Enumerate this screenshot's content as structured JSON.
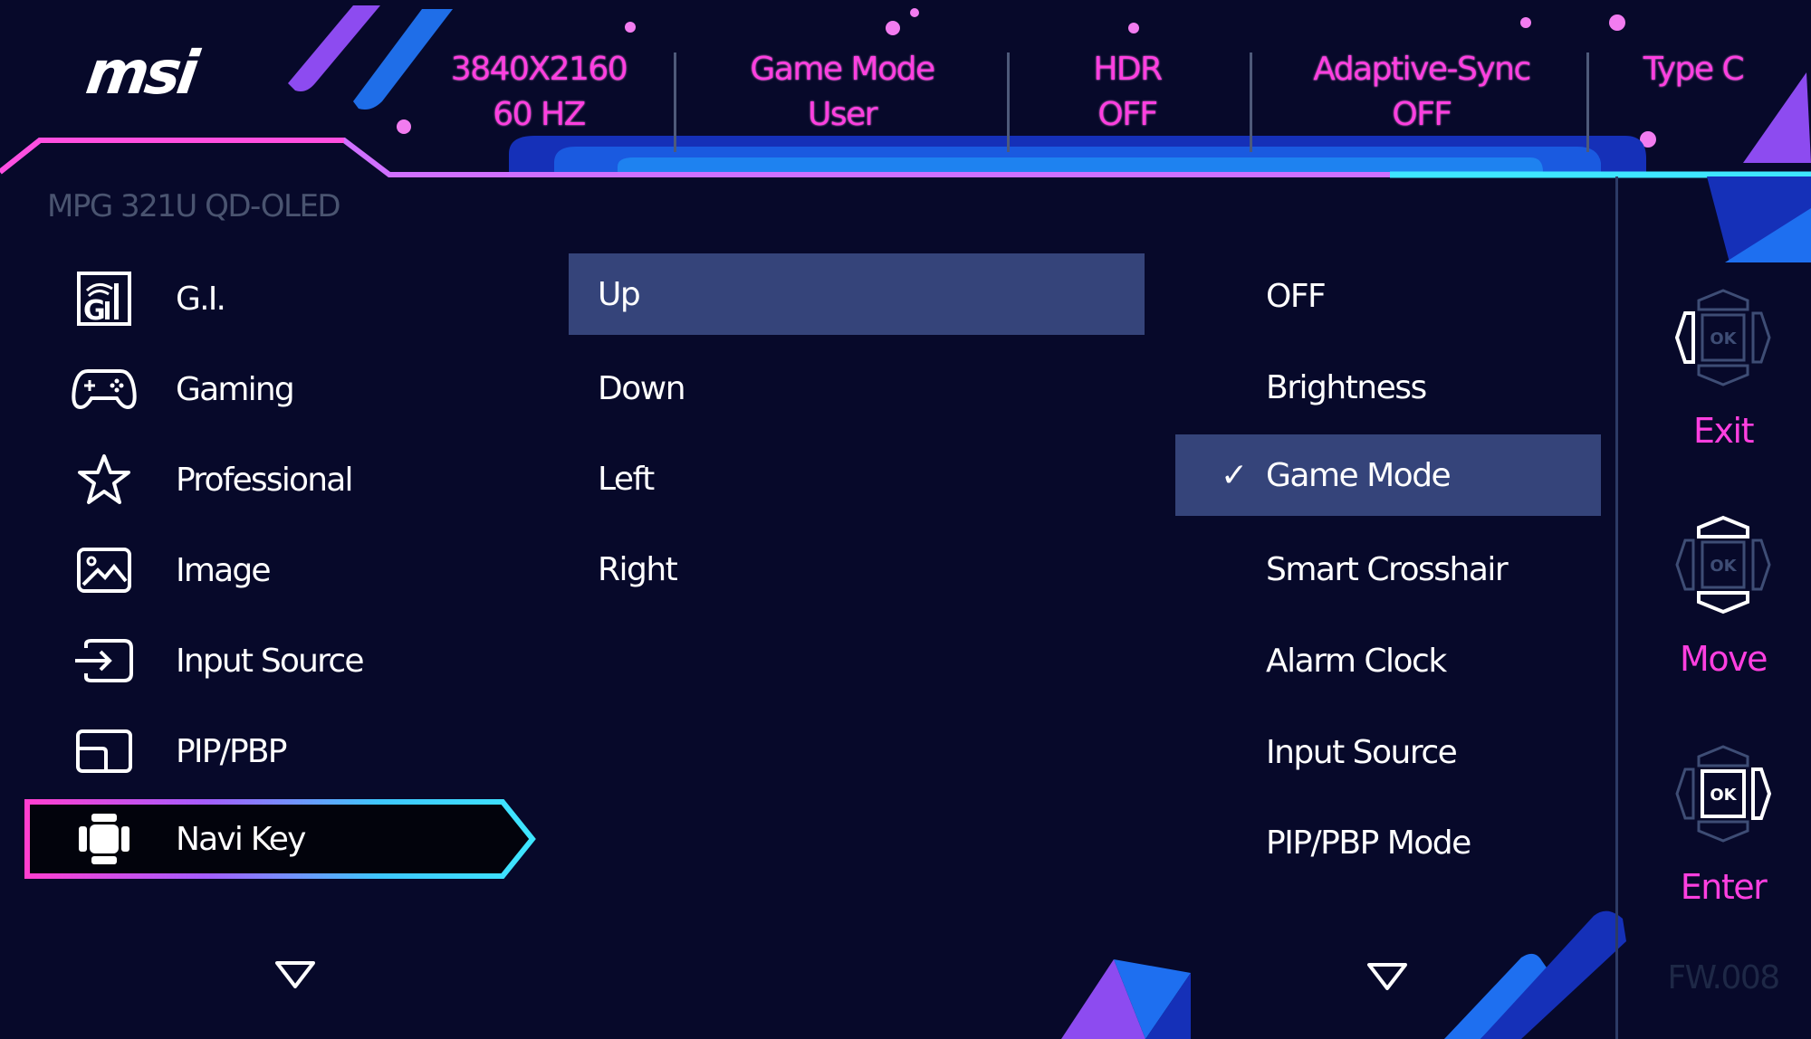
{
  "brand": {
    "logo": "msi",
    "model": "MPG 321U QD-OLED"
  },
  "status_bar": [
    {
      "title": "3840X2160",
      "value": "60 HZ"
    },
    {
      "title": "Game Mode",
      "value": "User"
    },
    {
      "title": "HDR",
      "value": "OFF"
    },
    {
      "title": "Adaptive-Sync",
      "value": "OFF"
    },
    {
      "title": "Type C",
      "value": ""
    }
  ],
  "sidebar": {
    "items": [
      {
        "label": "G.I.",
        "icon": "gi-icon"
      },
      {
        "label": "Gaming",
        "icon": "gamepad-icon"
      },
      {
        "label": "Professional",
        "icon": "star-icon"
      },
      {
        "label": "Image",
        "icon": "image-icon"
      },
      {
        "label": "Input Source",
        "icon": "input-source-icon"
      },
      {
        "label": "PIP/PBP",
        "icon": "pip-icon"
      },
      {
        "label": "Navi Key",
        "icon": "navi-key-icon",
        "active": true
      }
    ],
    "scroll_down": "more-down-icon"
  },
  "submenu": {
    "items": [
      {
        "label": "Up",
        "selected": true
      },
      {
        "label": "Down"
      },
      {
        "label": "Left"
      },
      {
        "label": "Right"
      }
    ]
  },
  "options": {
    "items": [
      {
        "label": "OFF"
      },
      {
        "label": "Brightness"
      },
      {
        "label": "Game Mode",
        "checked": true,
        "selected": true
      },
      {
        "label": "Smart Crosshair"
      },
      {
        "label": "Alarm Clock"
      },
      {
        "label": "Input Source"
      },
      {
        "label": "PIP/PBP Mode"
      }
    ],
    "check_glyph": "✓"
  },
  "key_guide": [
    {
      "label": "Exit",
      "icon": "joystick-left-icon",
      "ok": "OK"
    },
    {
      "label": "Move",
      "icon": "joystick-updown-icon",
      "ok": "OK"
    },
    {
      "label": "Enter",
      "icon": "joystick-ok-right-icon",
      "ok": "OK"
    }
  ],
  "firmware": "FW.008",
  "colors": {
    "background": "#07092a",
    "accent_pink": "#ff3fe0",
    "accent_cyan": "#3ee6ff",
    "highlight": "#35447a",
    "muted": "#4a5470"
  }
}
